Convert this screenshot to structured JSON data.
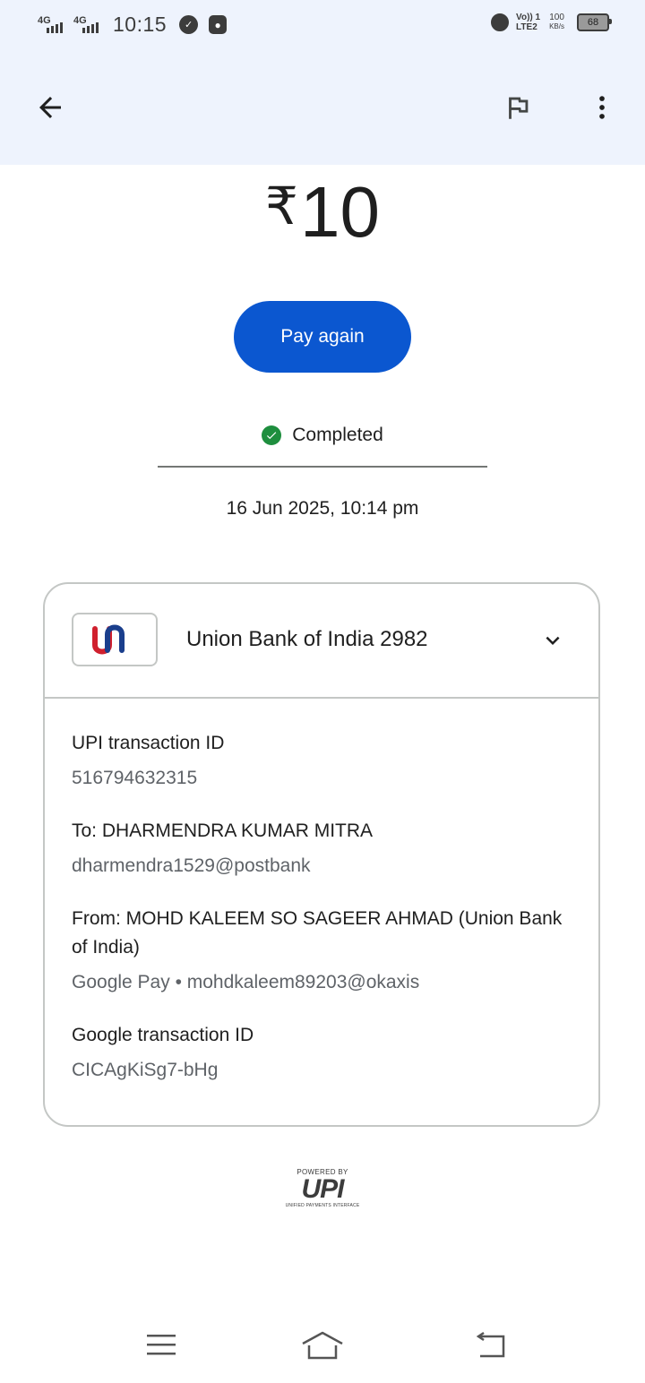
{
  "status_bar": {
    "sim1_network": "4G",
    "sim2_network": "4G",
    "time": "10:15",
    "volte_top": "Vo)) 1",
    "volte_bottom": "LTE2",
    "speed_value": "100",
    "speed_unit": "KB/s",
    "battery": "68"
  },
  "app_bar": {
    "back_icon": "arrow-left-icon",
    "report_icon": "flag-icon",
    "more_icon": "more-vertical-icon"
  },
  "transaction": {
    "currency_symbol": "₹",
    "amount": "10",
    "pay_again_label": "Pay again",
    "status": "Completed",
    "datetime": "16 Jun 2025, 10:14 pm"
  },
  "account": {
    "bank_name": "Union Bank of India 2982"
  },
  "details": {
    "upi_id_label": "UPI transaction ID",
    "upi_id_value": "516794632315",
    "to_label": "To: DHARMENDRA KUMAR MITRA",
    "to_value": "dharmendra1529@postbank",
    "from_label": "From: MOHD KALEEM SO SAGEER AHMAD (Union Bank of India)",
    "from_value": "Google Pay • mohdkaleem89203@okaxis",
    "google_id_label": "Google transaction ID",
    "google_id_value": "CICAgKiSg7-bHg"
  },
  "footer": {
    "powered_by": "POWERED BY",
    "upi_logo": "UPI",
    "upi_subtitle": "UNIFIED PAYMENTS INTERFACE"
  },
  "colors": {
    "accent": "#0b57d0",
    "success": "#1e8e3e",
    "header_bg": "#eef3fd"
  }
}
